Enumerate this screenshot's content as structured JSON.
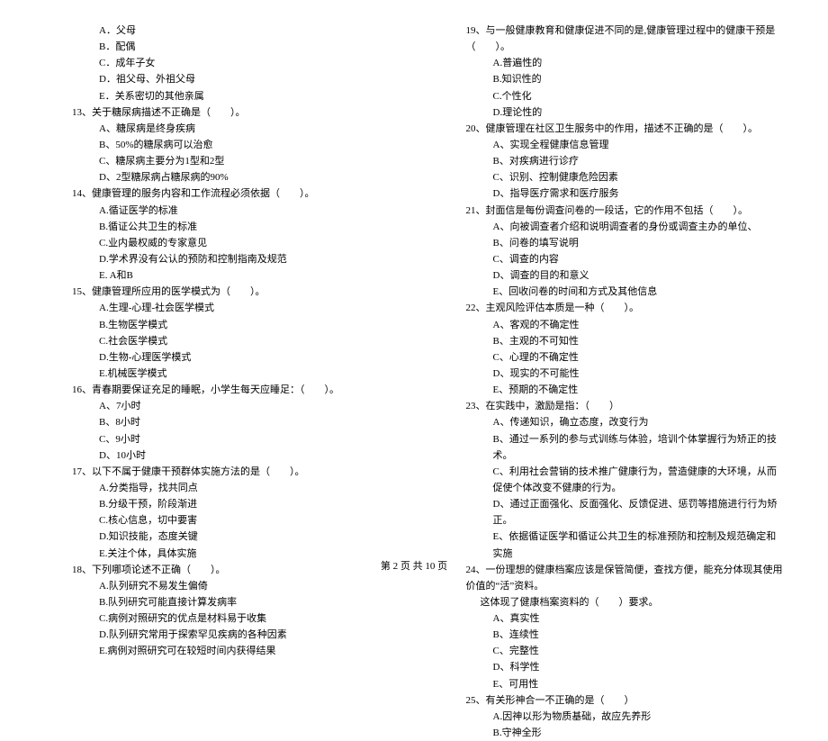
{
  "left": {
    "q12_options": [
      "A．父母",
      "B．配偶",
      "C．成年子女",
      "D．祖父母、外祖父母",
      "E．关系密切的其他亲属"
    ],
    "q13": "13、关于糖尿病描述不正确是（　　）。",
    "q13_options": [
      "A、糖尿病是终身疾病",
      "B、50%的糖尿病可以治愈",
      "C、糖尿病主要分为1型和2型",
      "D、2型糖尿病占糖尿病的90%"
    ],
    "q14": "14、健康管理的服务内容和工作流程必须依据（　　）。",
    "q14_options": [
      "A.循证医学的标准",
      "B.循证公共卫生的标准",
      "C.业内最权威的专家意见",
      "D.学术界没有公认的预防和控制指南及规范",
      "E. A和B"
    ],
    "q15": "15、健康管理所应用的医学模式为（　　）。",
    "q15_options": [
      "A.生理-心理-社会医学模式",
      "B.生物医学模式",
      "C.社会医学模式",
      "D.生物-心理医学模式",
      "E.机械医学模式"
    ],
    "q16": "16、青春期要保证充足的睡眠，小学生每天应睡足：（　　）。",
    "q16_options": [
      "A、7小时",
      "B、8小时",
      "C、9小时",
      "D、10小时"
    ],
    "q17": "17、以下不属于健康干预群体实施方法的是（　　）。",
    "q17_options": [
      "A.分类指导，找共同点",
      "B.分级干预，阶段渐进",
      "C.核心信息，切中要害",
      "D.知识技能，态度关键",
      "E.关注个体，具体实施"
    ],
    "q18": "18、下列哪项论述不正确（　　）。",
    "q18_options": [
      "A.队列研究不易发生偏倚",
      "B.队列研究可能直接计算发病率",
      "C.病例对照研究的优点是材料易于收集",
      "D.队列研究常用于探索罕见疾病的各种因素",
      "E.病例对照研究可在较短时间内获得结果"
    ]
  },
  "right": {
    "q19": "19、与一般健康教育和健康促进不同的是,健康管理过程中的健康干预是（　　）。",
    "q19_options": [
      "A.普遍性的",
      "B.知识性的",
      "C.个性化",
      "D.理论性的"
    ],
    "q20": "20、健康管理在社区卫生服务中的作用，描述不正确的是（　　）。",
    "q20_options": [
      "A、实现全程健康信息管理",
      "B、对疾病进行诊疗",
      "C、识别、控制健康危险因素",
      "D、指导医疗需求和医疗服务"
    ],
    "q21": "21、封面信是每份调查问卷的一段话，它的作用不包括（　　）。",
    "q21_options": [
      "A、向被调查者介绍和说明调查者的身份或调查主办的单位、",
      "B、问卷的填写说明",
      "C、调查的内容",
      "D、调查的目的和意义",
      "E、回收问卷的时间和方式及其他信息"
    ],
    "q22": "22、主观风险评估本质是一种（　　）。",
    "q22_options": [
      "A、客观的不确定性",
      "B、主观的不可知性",
      "C、心理的不确定性",
      "D、现实的不可能性",
      "E、预期的不确定性"
    ],
    "q23": "23、在实践中，激励是指：（　　）",
    "q23_options": [
      "A、传递知识，确立态度，改变行为",
      "B、通过一系列的参与式训练与体验，培训个体掌握行为矫正的技术。",
      "C、利用社会营销的技术推广健康行为，营造健康的大环境，从而促使个体改变不健康的行为。",
      "D、通过正面强化、反面强化、反馈促进、惩罚等措施进行行为矫正。",
      "E、依据循证医学和循证公共卫生的标准预防和控制及规范确定和实施"
    ],
    "q24": "24、一份理想的健康档案应该是保管简便，查找方便，能充分体现其使用价值的“活”资料。",
    "q24_cont": "这体现了健康档案资料的（　　）要求。",
    "q24_options": [
      "A、真实性",
      "B、连续性",
      "C、完整性",
      "D、科学性",
      "E、可用性"
    ],
    "q25": "25、有关形神合一不正确的是（　　）",
    "q25_options": [
      "A.因神以形为物质基础，故应先养形",
      "B.守神全形"
    ]
  },
  "footer": "第 2 页 共 10 页"
}
